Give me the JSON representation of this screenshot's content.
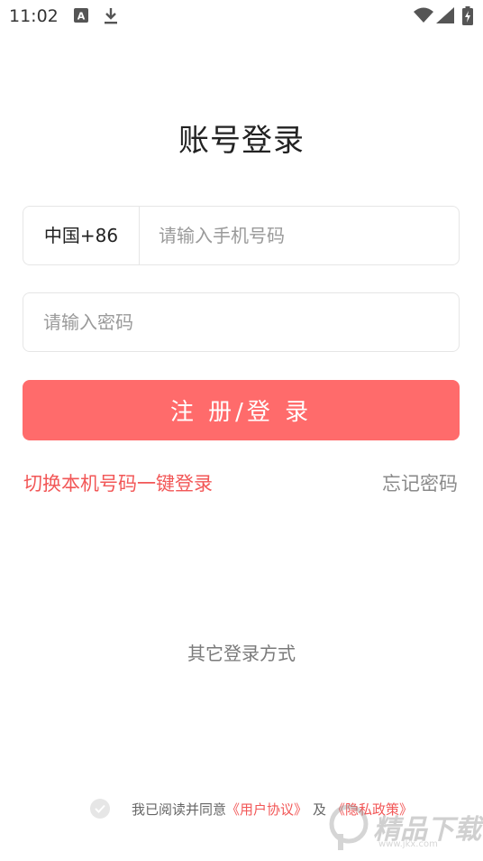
{
  "status_bar": {
    "time": "11:02"
  },
  "title": "账号登录",
  "phone": {
    "country_code": "中国+86",
    "placeholder": "请输入手机号码"
  },
  "password": {
    "placeholder": "请输入密码"
  },
  "login_button": "注 册/登 录",
  "switch_login": "切换本机号码一键登录",
  "forgot_password": "忘记密码",
  "other_methods": "其它登录方式",
  "agreement": {
    "prefix": "我已阅读并同意",
    "user_agreement": "《用户协议》",
    "and": "及",
    "privacy_policy": "《隐私政策》"
  },
  "watermark": {
    "text": "精品下载",
    "url": "www.jkx.com"
  },
  "colors": {
    "accent": "#ff6b6b",
    "link": "#f25757",
    "border": "#e6e6e6"
  }
}
